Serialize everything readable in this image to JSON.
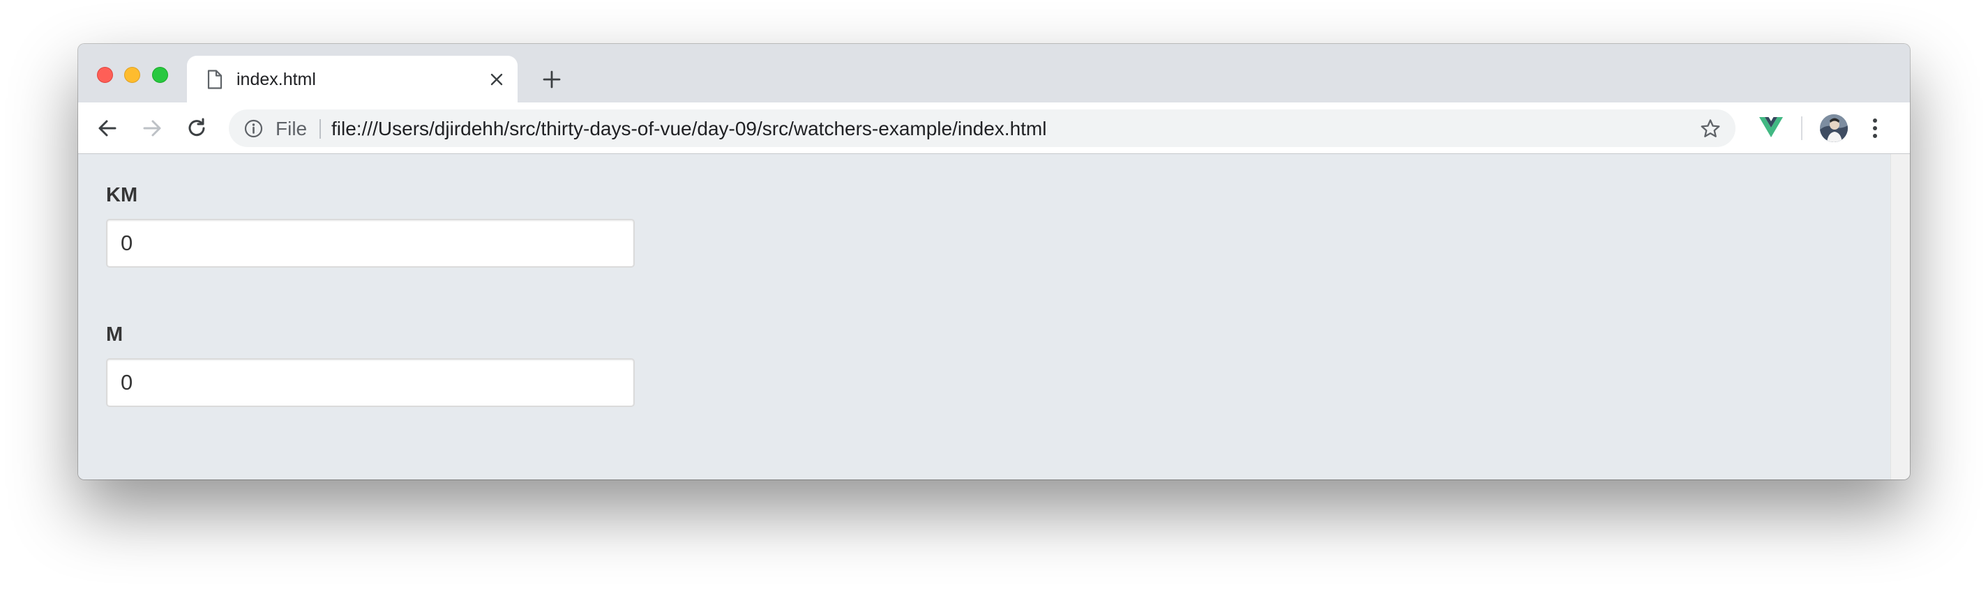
{
  "browser": {
    "tab": {
      "title": "index.html",
      "icon": "file-icon"
    },
    "toolbar": {
      "back_icon": "arrow-left-icon",
      "forward_icon": "arrow-right-icon",
      "reload_icon": "reload-icon",
      "address": {
        "security_chip": "File",
        "url": "file:///Users/djirdehh/src/thirty-days-of-vue/day-09/src/watchers-example/index.html"
      },
      "bookmark_icon": "star-icon",
      "extension_icon": "vue-devtools-icon",
      "menu_icon": "three-dots-menu-icon"
    },
    "colors": {
      "close": "#fe5f57",
      "minimize": "#febc2e",
      "maximize": "#28c840",
      "vue_green": "#42b883",
      "vue_dark": "#35495e",
      "page_background": "#e6eaee"
    }
  },
  "page": {
    "fields": [
      {
        "label": "KM",
        "value": "0"
      },
      {
        "label": "M",
        "value": "0"
      }
    ]
  }
}
